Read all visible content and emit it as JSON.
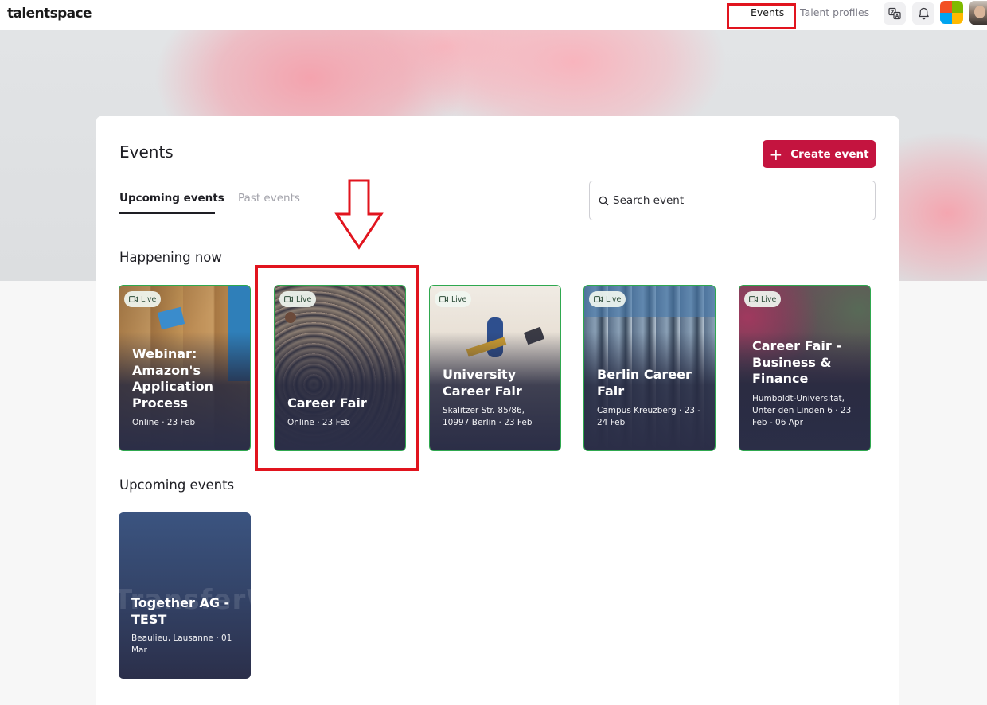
{
  "topbar": {
    "logo": "talentspace",
    "nav": {
      "events": "Events",
      "talent_profiles": "Talent profiles"
    },
    "icons": [
      "translate-icon",
      "bell-icon",
      "microsoft-logo",
      "user-avatar"
    ]
  },
  "page": {
    "title": "Events",
    "create_label": "Create event",
    "tabs": {
      "upcoming": "Upcoming events",
      "past": "Past events"
    },
    "search_placeholder": "Search event"
  },
  "happening_now": {
    "title": "Happening now",
    "cards": [
      {
        "badge": "Live",
        "title": "Webinar: Amazon's Application Process",
        "meta": "Online · 23 Feb"
      },
      {
        "badge": "Live",
        "title": "Career Fair",
        "meta": "Online · 23 Feb"
      },
      {
        "badge": "Live",
        "title": "University Career Fair",
        "meta": "Skalitzer Str. 85/86, 10997 Berlin · 23 Feb"
      },
      {
        "badge": "Live",
        "title": "Berlin Career Fair",
        "meta": "Campus Kreuzberg · 23 - 24 Feb"
      },
      {
        "badge": "Live",
        "title": "Career Fair - Business & Finance",
        "meta": "Humboldt-Universität, Unter den Linden 6 · 23 Feb - 06 Apr"
      }
    ]
  },
  "upcoming": {
    "title": "Upcoming events",
    "cards": [
      {
        "title": "Together AG - TEST",
        "meta": "Beaulieu, Lausanne · 01 Mar",
        "watermark": "TransferW"
      }
    ]
  },
  "colors": {
    "brand": "#c4143f",
    "live_border": "#2fa84f",
    "annotation": "#e1141e"
  }
}
